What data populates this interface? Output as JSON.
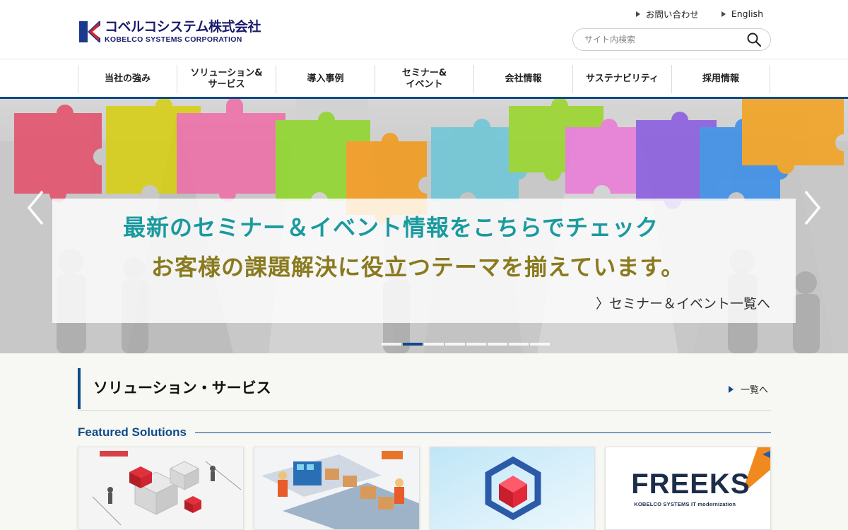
{
  "header": {
    "logo_jp": "コベルコシステム株式会社",
    "logo_en": "KOBELCO SYSTEMS CORPORATION",
    "util_links": [
      {
        "label": "お問い合わせ"
      },
      {
        "label": "English"
      }
    ],
    "search": {
      "placeholder": "サイト内検索",
      "icon": "search-icon"
    }
  },
  "nav": {
    "items": [
      {
        "label": "当社の強み"
      },
      {
        "label": "ソリューション&\nサービス"
      },
      {
        "label": "導入事例"
      },
      {
        "label": "セミナー&\nイベント"
      },
      {
        "label": "会社情報"
      },
      {
        "label": "サステナビリティ"
      },
      {
        "label": "採用情報"
      }
    ]
  },
  "hero": {
    "line1": "最新のセミナー＆イベント情報をこちらでチェック",
    "line2": "お客様の課題解決に役立つテーマを揃えています。",
    "link": "〉セミナー＆イベント一覧へ",
    "slide_count": 8,
    "active_slide": 2,
    "accent_color": "#0f4a8a"
  },
  "solutions": {
    "title": "ソリューション・サービス",
    "more_label": "一覧へ",
    "featured_label": "Featured Solutions",
    "cards": [
      {
        "kind": "isometric-blocks-illustration"
      },
      {
        "kind": "factory-workers-illustration"
      },
      {
        "kind": "cube-logo-illustration"
      },
      {
        "kind": "freeks-logo",
        "title": "FREEKS",
        "subtitle": "KOBELCO SYSTEMS  IT modernization"
      }
    ]
  }
}
